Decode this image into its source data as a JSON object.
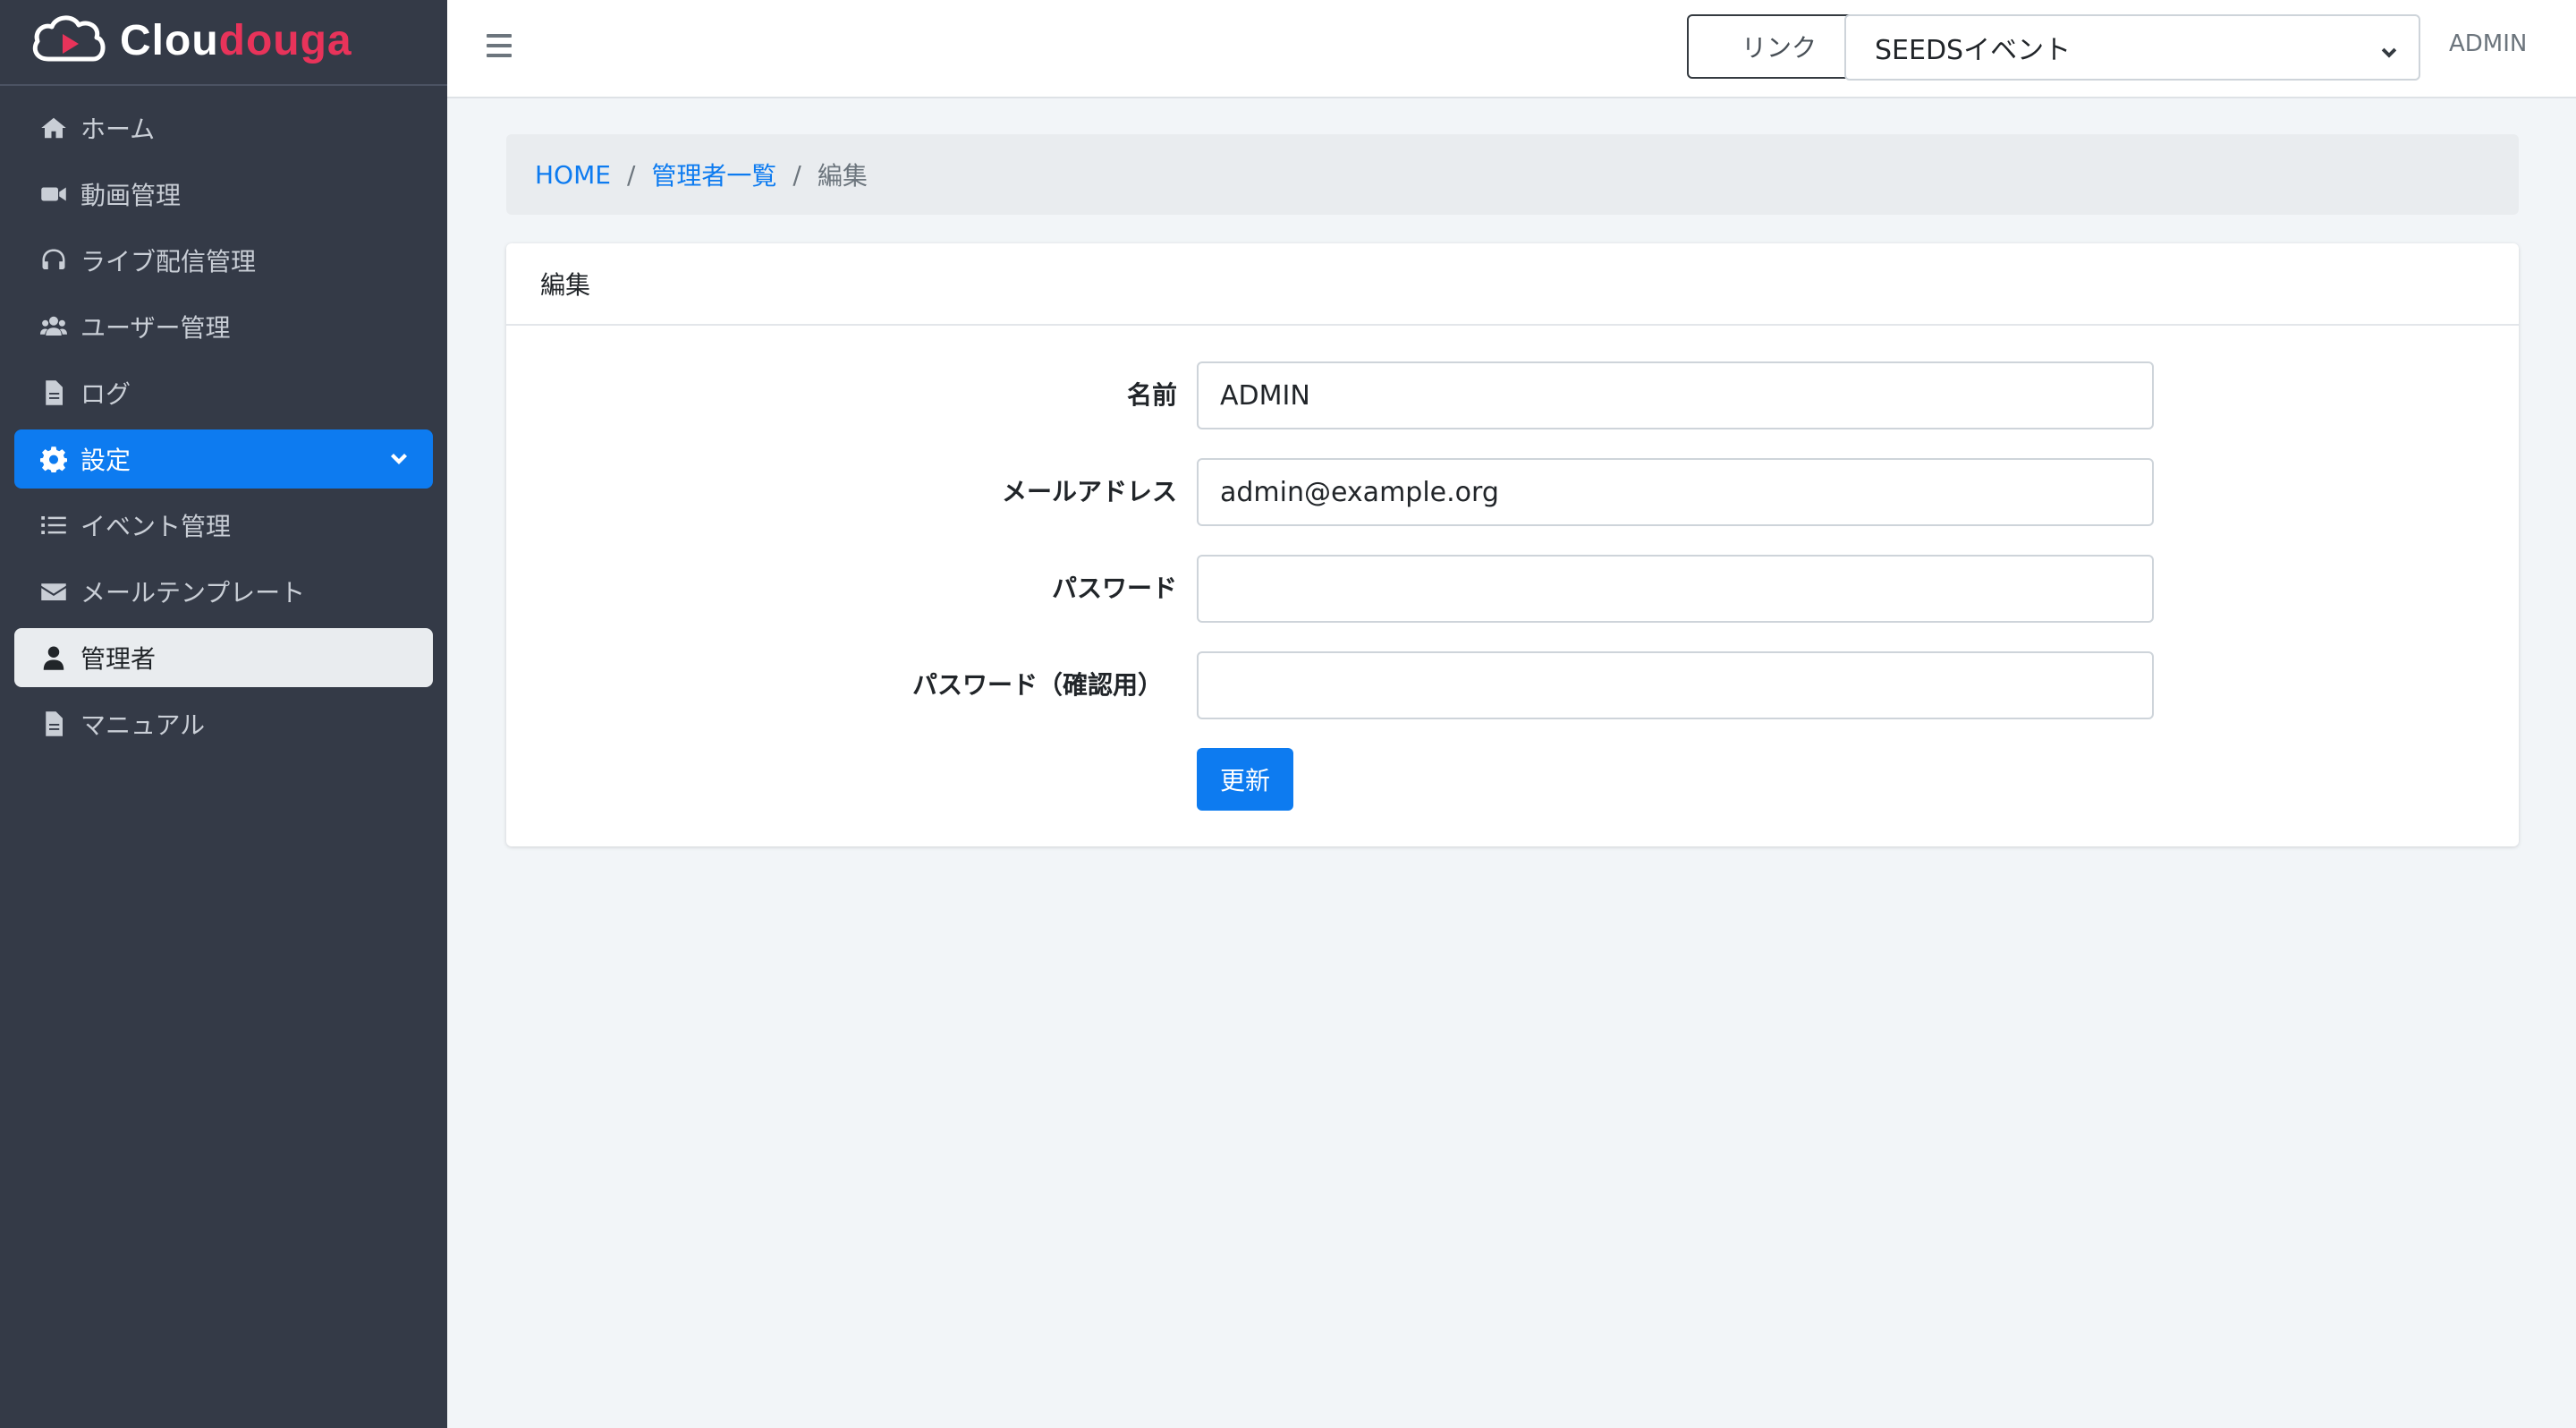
{
  "brand": {
    "name_part1": "Clou",
    "name_part2": "douga",
    "accent": "#e8335a"
  },
  "sidebar": {
    "items": [
      {
        "label": "ホーム",
        "icon": "home-icon"
      },
      {
        "label": "動画管理",
        "icon": "video-camera-icon"
      },
      {
        "label": "ライブ配信管理",
        "icon": "headset-icon"
      },
      {
        "label": "ユーザー管理",
        "icon": "users-icon"
      },
      {
        "label": "ログ",
        "icon": "file-icon"
      },
      {
        "label": "設定",
        "icon": "gear-icon",
        "state": "expanded"
      },
      {
        "label": "イベント管理",
        "icon": "list-icon"
      },
      {
        "label": "メールテンプレート",
        "icon": "envelope-icon"
      },
      {
        "label": "管理者",
        "icon": "user-icon",
        "state": "current"
      },
      {
        "label": "マニュアル",
        "icon": "file-icon"
      }
    ]
  },
  "topbar": {
    "link_label": "リンク",
    "event_select_value": "SEEDSイベント",
    "user_name": "ADMIN"
  },
  "breadcrumb": {
    "home": "HOME",
    "list": "管理者一覧",
    "current": "編集",
    "separator": "/"
  },
  "card": {
    "title": "編集",
    "fields": {
      "name_label": "名前",
      "name_value": "ADMIN",
      "email_label": "メールアドレス",
      "email_value": "admin@example.org",
      "password_label": "パスワード",
      "password_value": "",
      "password_confirm_label": "パスワード（確認用）",
      "password_confirm_value": ""
    },
    "submit_label": "更新"
  },
  "colors": {
    "primary": "#0d7bf0",
    "sidebar_bg": "#343a47",
    "page_bg": "#f2f5f8"
  }
}
